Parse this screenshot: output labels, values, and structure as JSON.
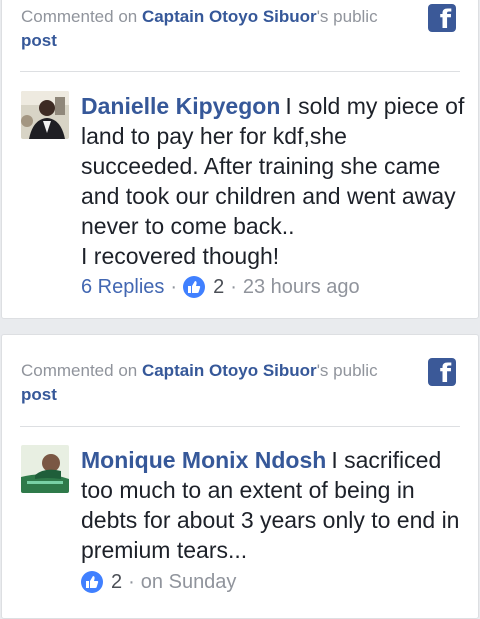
{
  "comments": [
    {
      "header_prefix": "Commented on ",
      "page_name": "Captain Otoyo Sibuor",
      "header_suffix": "'s public",
      "header_post": "post",
      "author": "Danielle Kipyegon",
      "text": "I sold my piece of land to pay her for kdf,she succeeded. After training she came and took our children and went away never to come back..",
      "text_line2": "I recovered though!",
      "replies": "6 Replies",
      "likes": "2",
      "time": "23 hours ago"
    },
    {
      "header_prefix": "Commented on ",
      "page_name": "Captain Otoyo Sibuor",
      "header_suffix": "'s public",
      "header_post": "post",
      "author": "Monique Monix Ndosh",
      "text": "I sacrificed too much to an extent of being in debts for about 3 years only to end in premium tears...",
      "likes": "2",
      "time": "on Sunday"
    }
  ],
  "separator": "·",
  "icons": {
    "facebook": "facebook-icon",
    "like": "like-icon",
    "brand_color": "#3b5998",
    "like_color": "#4080ff",
    "link_color": "#365899"
  }
}
